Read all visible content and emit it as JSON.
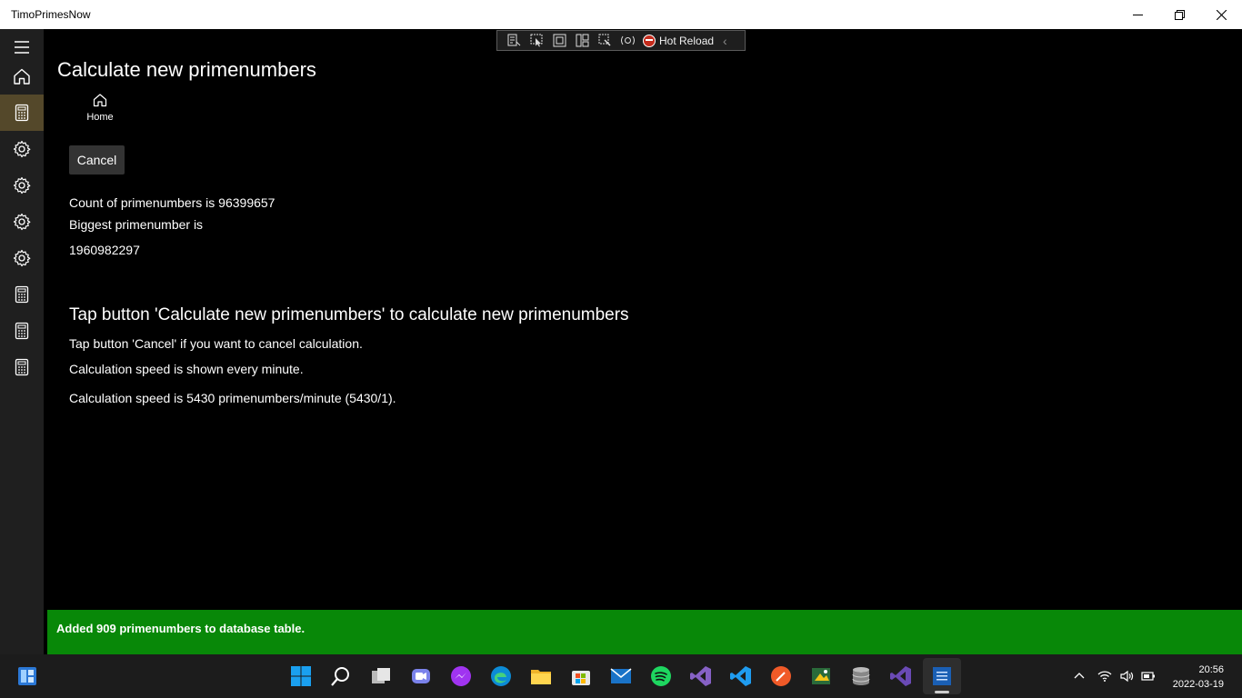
{
  "window": {
    "title": "TimoPrimesNow"
  },
  "hot_reload": {
    "label": "Hot Reload"
  },
  "page": {
    "title": "Calculate new primenumbers",
    "home_label": "Home",
    "cancel_label": "Cancel",
    "count_text": "Count of primenumbers is 96399657",
    "biggest_label": "Biggest primenumber is",
    "biggest_value": "1960982297",
    "heading": "Tap button 'Calculate new primenumbers' to calculate new primenumbers",
    "cancel_info": "Tap button 'Cancel' if you want to cancel calculation.",
    "speed_info": "Calculation speed is shown every minute.",
    "speed_value": "Calculation speed is 5430 primenumbers/minute (5430/1)."
  },
  "notification": {
    "text": "Added 909 primenumbers to database table.",
    "color": "#088808"
  },
  "taskbar": {
    "time": "20:56",
    "date": "2022-03-19"
  },
  "colors": {
    "nav_selected": "#54482a",
    "nav_bg": "#1f1f1f",
    "accent_windows": "#0078d4"
  }
}
